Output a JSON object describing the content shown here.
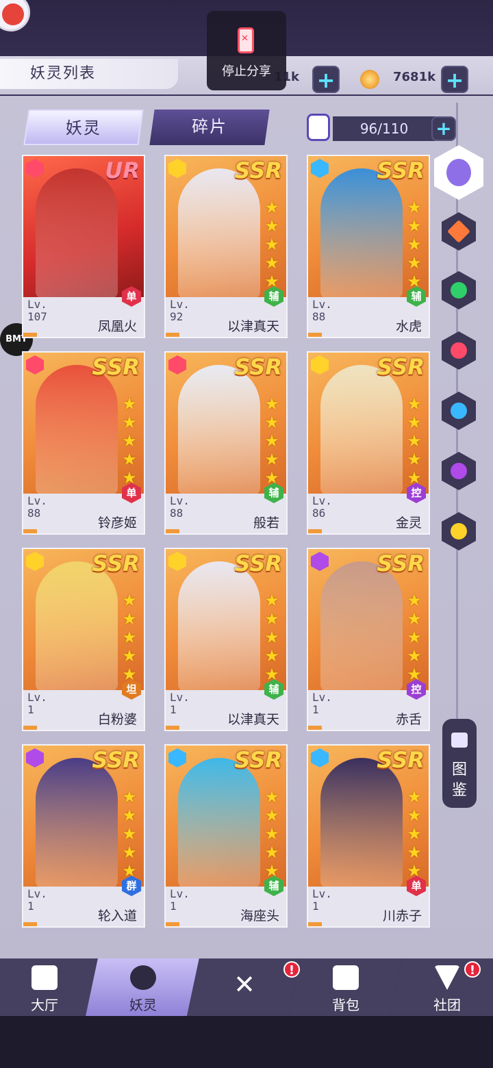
{
  "header": {
    "title": "妖灵列表"
  },
  "share_overlay": {
    "label": "停止分享"
  },
  "resources": [
    {
      "value": "11k",
      "icon": "gem-icon"
    },
    {
      "value": "7681k",
      "icon": "coin-icon"
    }
  ],
  "tabs": [
    {
      "label": "妖灵",
      "active": true
    },
    {
      "label": "碎片",
      "active": false
    }
  ],
  "capacity": {
    "value": "96/110"
  },
  "watermark": "BMT",
  "filters": [
    "all-element",
    "fire-orange",
    "wind",
    "fire",
    "water",
    "eye",
    "light"
  ],
  "codex": {
    "label": "图鉴"
  },
  "cards": [
    {
      "rarity": "UR",
      "level_label": "Lv.",
      "level": "107",
      "name": "凤凰火",
      "role": "单",
      "stars": 0,
      "element": "fire"
    },
    {
      "rarity": "SSR",
      "level_label": "Lv.",
      "level": "92",
      "name": "以津真天",
      "role": "辅",
      "stars": 5,
      "element": "light"
    },
    {
      "rarity": "SSR",
      "level_label": "Lv.",
      "level": "88",
      "name": "水虎",
      "role": "辅",
      "stars": 5,
      "element": "water"
    },
    {
      "rarity": "SSR",
      "level_label": "Lv.",
      "level": "88",
      "name": "铃彦姬",
      "role": "单",
      "stars": 5,
      "element": "fire"
    },
    {
      "rarity": "SSR",
      "level_label": "Lv.",
      "level": "88",
      "name": "般若",
      "role": "辅",
      "stars": 5,
      "element": "fire"
    },
    {
      "rarity": "SSR",
      "level_label": "Lv.",
      "level": "86",
      "name": "金灵",
      "role": "控",
      "stars": 5,
      "element": "light"
    },
    {
      "rarity": "SSR",
      "level_label": "Lv.",
      "level": "1",
      "name": "白粉婆",
      "role": "坦",
      "stars": 5,
      "element": "light"
    },
    {
      "rarity": "SSR",
      "level_label": "Lv.",
      "level": "1",
      "name": "以津真天",
      "role": "辅",
      "stars": 5,
      "element": "light"
    },
    {
      "rarity": "SSR",
      "level_label": "Lv.",
      "level": "1",
      "name": "赤舌",
      "role": "控",
      "stars": 5,
      "element": "eye"
    },
    {
      "rarity": "SSR",
      "level_label": "Lv.",
      "level": "1",
      "name": "轮入道",
      "role": "群",
      "stars": 5,
      "element": "eye"
    },
    {
      "rarity": "SSR",
      "level_label": "Lv.",
      "level": "1",
      "name": "海座头",
      "role": "辅",
      "stars": 5,
      "element": "water"
    },
    {
      "rarity": "SSR",
      "level_label": "Lv.",
      "level": "1",
      "name": "川赤子",
      "role": "单",
      "stars": 5,
      "element": "water"
    }
  ],
  "nav": [
    {
      "label": "大厅",
      "icon": "home-icon"
    },
    {
      "label": "妖灵",
      "icon": "spirit-icon",
      "selected": true
    },
    {
      "label": "",
      "icon": "battle-swords-icon",
      "badge": "!"
    },
    {
      "label": "背包",
      "icon": "backpack-icon"
    },
    {
      "label": "社团",
      "icon": "guild-icon",
      "badge": "!"
    }
  ],
  "colors": {
    "accent": "#5fe3ff",
    "role_dps": "#e0314b",
    "role_support": "#3fb24a",
    "role_control": "#9b3fd3",
    "role_tank": "#e07b22",
    "role_aoe": "#2f6fe0"
  }
}
